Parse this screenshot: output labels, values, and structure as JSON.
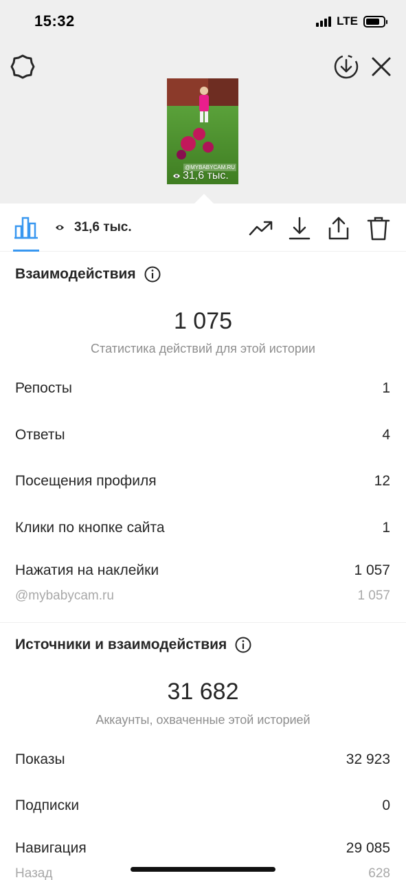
{
  "status_bar": {
    "time": "15:32",
    "network": "LTE"
  },
  "header": {
    "icons": [
      "gear-icon",
      "download-circle-icon",
      "close-icon"
    ]
  },
  "story_thumbnail": {
    "sticker_text": "@MYBABYCAM.RU",
    "views": "31,6 тыс."
  },
  "toolbar": {
    "views": "31,6 тыс.",
    "icons": [
      "bar-chart-icon",
      "eye-icon",
      "trending-icon",
      "download-icon",
      "share-icon",
      "trash-icon"
    ],
    "accent_color": "#3897f0"
  },
  "interactions": {
    "title": "Взаимодействия",
    "total": "1 075",
    "caption": "Статистика действий для этой истории",
    "rows": [
      {
        "label": "Репосты",
        "value": "1"
      },
      {
        "label": "Ответы",
        "value": "4"
      },
      {
        "label": "Посещения профиля",
        "value": "12"
      },
      {
        "label": "Клики по кнопке сайта",
        "value": "1"
      },
      {
        "label": "Нажатия на наклейки",
        "value": "1 057"
      }
    ],
    "sub_row": {
      "label": "@mybabycam.ru",
      "value": "1 057"
    }
  },
  "discovery": {
    "title": "Источники и взаимодействия",
    "total": "31 682",
    "caption": "Аккаунты, охваченные этой историей",
    "rows": [
      {
        "label": "Показы",
        "value": "32 923"
      },
      {
        "label": "Подписки",
        "value": "0"
      },
      {
        "label": "Навигация",
        "value": "29 085"
      }
    ],
    "sub_row": {
      "label": "Назад",
      "value": "628"
    }
  }
}
